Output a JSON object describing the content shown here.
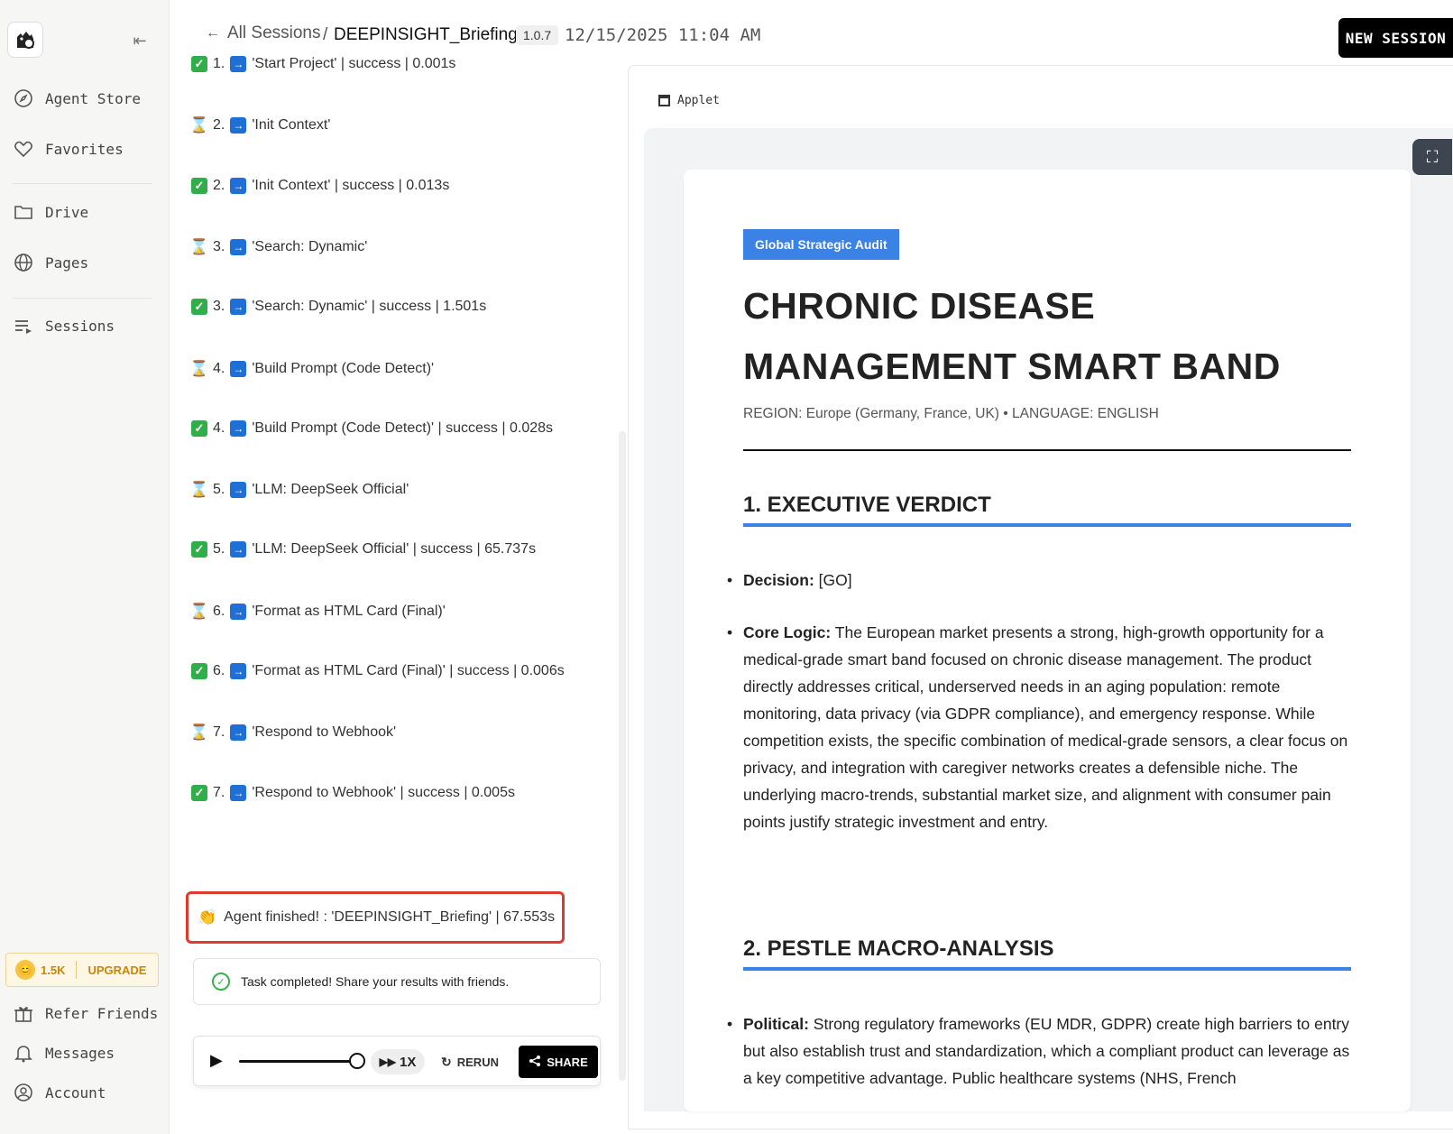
{
  "sidebar": {
    "items": [
      {
        "label": "Agent Store",
        "icon": "compass-icon"
      },
      {
        "label": "Favorites",
        "icon": "heart-icon"
      },
      {
        "label": "Drive",
        "icon": "folder-icon"
      },
      {
        "label": "Pages",
        "icon": "globe-icon"
      },
      {
        "label": "Sessions",
        "icon": "list-icon"
      }
    ],
    "credits": "1.5K",
    "upgrade": "UPGRADE",
    "bottom": [
      {
        "label": "Refer Friends",
        "icon": "gift-icon"
      },
      {
        "label": "Messages",
        "icon": "bell-icon"
      },
      {
        "label": "Account",
        "icon": "user-icon"
      }
    ]
  },
  "header": {
    "back_label": "All Sessions",
    "separator": "/",
    "session_title": "DEEPINSIGHT_Briefing",
    "version": "1.0.7",
    "datetime": "12/15/2025 11:04 AM",
    "new_session": "NEW SESSION"
  },
  "log": [
    {
      "status": "done",
      "text": "1.  'Start Project' | success | 0.001s"
    },
    {
      "status": "pending",
      "text": "2.  'Init Context'"
    },
    {
      "status": "done",
      "text": "2.  'Init Context' | success | 0.013s"
    },
    {
      "status": "pending",
      "text": "3.  'Search: Dynamic'"
    },
    {
      "status": "done",
      "text": "3.  'Search: Dynamic' | success | 1.501s"
    },
    {
      "status": "pending",
      "text": "4.  'Build Prompt (Code Detect)'"
    },
    {
      "status": "done",
      "text": "4.  'Build Prompt (Code Detect)' | success | 0.028s"
    },
    {
      "status": "pending",
      "text": "5.  'LLM: DeepSeek Official'"
    },
    {
      "status": "done",
      "text": "5.  'LLM: DeepSeek Official' | success | 65.737s"
    },
    {
      "status": "pending",
      "text": "6.  'Format as HTML Card (Final)'"
    },
    {
      "status": "done",
      "text": "6.  'Format as HTML Card (Final)' | success | 0.006s"
    },
    {
      "status": "pending",
      "text": "7.  'Respond to Webhook'"
    },
    {
      "status": "done",
      "text": "7.  'Respond to Webhook' | success | 0.005s"
    }
  ],
  "finished": "Agent finished! : 'DEEPINSIGHT_Briefing' | 67.553s",
  "task_done": "Task completed! Share your results with friends.",
  "player": {
    "speed": "1X",
    "rerun": "RERUN",
    "share": "SHARE",
    "progress": 1.0
  },
  "applet": {
    "tab": "Applet",
    "badge": "Global Strategic Audit",
    "title": "CHRONIC DISEASE MANAGEMENT SMART BAND",
    "meta": "REGION: Europe (Germany, France, UK) • LANGUAGE: ENGLISH",
    "section1": "1. EXECUTIVE VERDICT",
    "decision_label": "Decision:",
    "decision_value": " [GO]",
    "core_label": "Core Logic:",
    "core_text": " The European market presents a strong, high-growth opportunity for a medical-grade smart band focused on chronic disease management. The product directly addresses critical, underserved needs in an aging population: remote monitoring, data privacy (via GDPR compliance), and emergency response. While competition exists, the specific combination of medical-grade sensors, a clear focus on privacy, and integration with caregiver networks creates a defensible niche. The underlying macro-trends, substantial market size, and alignment with consumer pain points justify strategic investment and entry.",
    "section2": "2. PESTLE MACRO-ANALYSIS",
    "political_label": "Political:",
    "political_text": " Strong regulatory frameworks (EU MDR, GDPR) create high barriers to entry but also establish trust and standardization, which a compliant product can leverage as a key competitive advantage. Public healthcare systems (NHS, French"
  }
}
